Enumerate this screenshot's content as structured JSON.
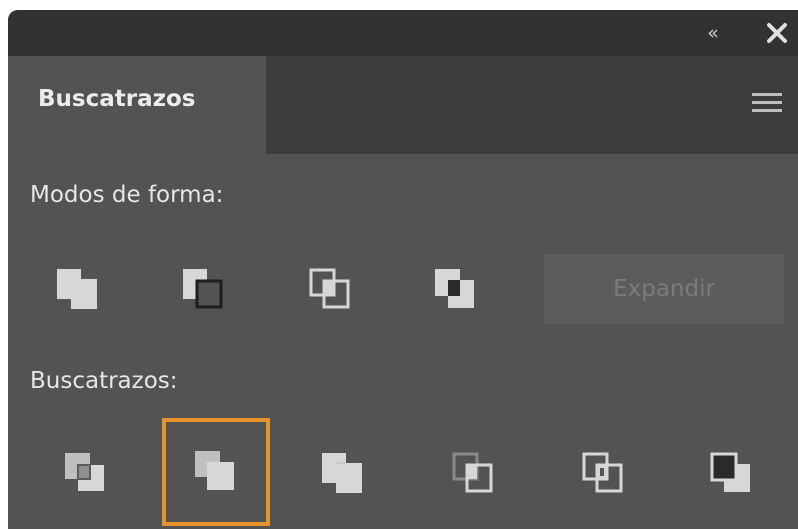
{
  "panel": {
    "tab_label": "Buscatrazos",
    "collapse_glyph": "«",
    "close_icon": "close-icon",
    "menu_icon": "hamburger-menu-icon"
  },
  "shape_modes": {
    "label": "Modos de forma:",
    "buttons": [
      "unite-icon",
      "minus-front-icon",
      "intersect-icon",
      "exclude-icon"
    ],
    "expand_label": "Expandir",
    "expand_enabled": false
  },
  "pathfinders": {
    "label": "Buscatrazos:",
    "buttons": [
      "divide-icon",
      "trim-icon",
      "merge-icon",
      "crop-icon",
      "outline-icon",
      "minus-back-icon"
    ],
    "selected": "trim-icon"
  },
  "colors": {
    "panel_bg": "#535353",
    "titlebar_bg": "#323232",
    "selection_border": "#e8922a"
  }
}
